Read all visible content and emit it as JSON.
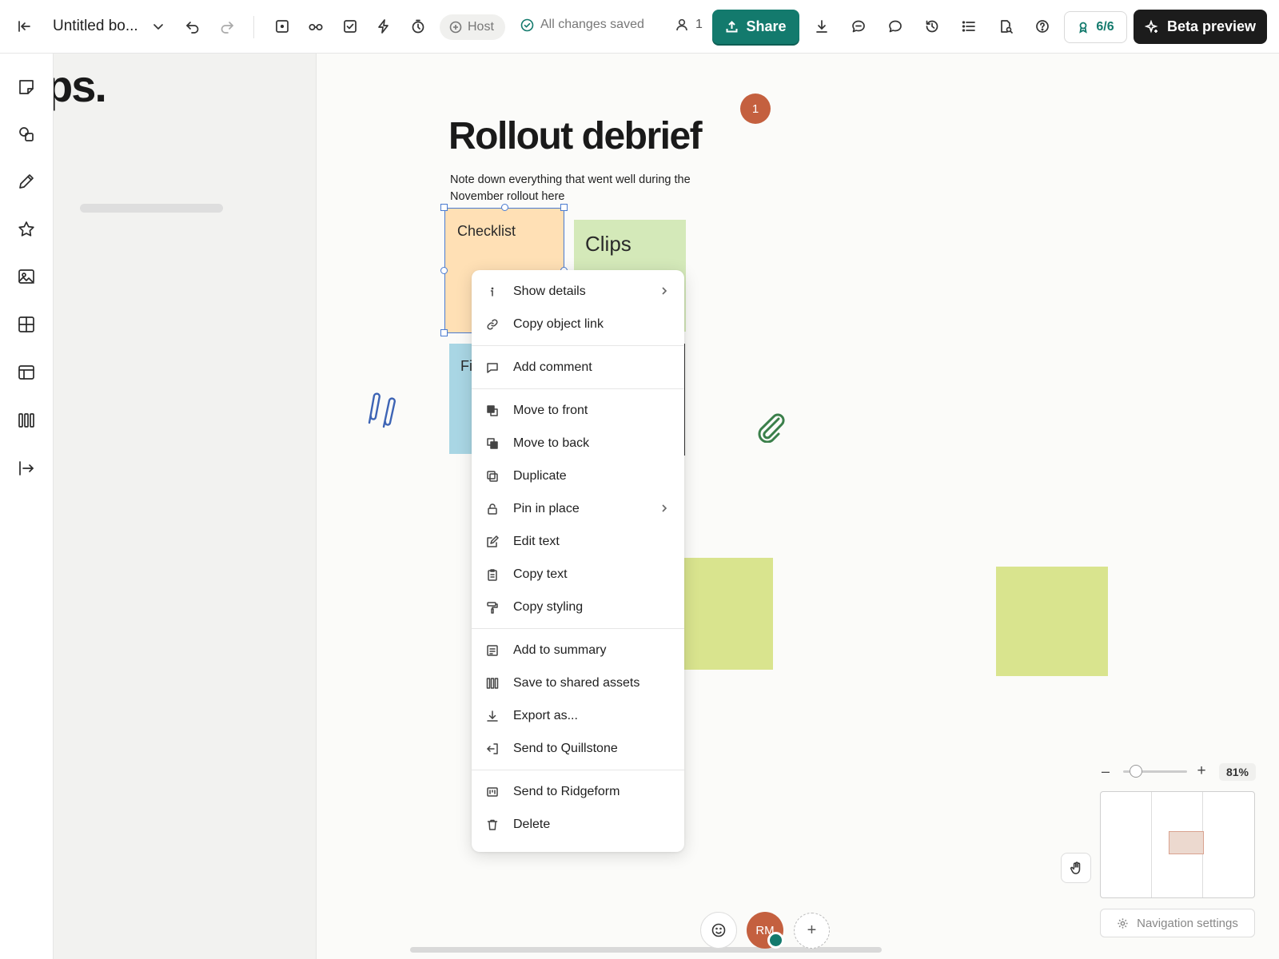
{
  "topbar": {
    "board_title": "Untitled bo...",
    "host_label": "Host",
    "save_status": "All changes saved",
    "collaborators_count": "1",
    "share_label": "Share",
    "badge_count": "6/6",
    "beta_label": "Beta preview"
  },
  "frame": {
    "heading": "ps."
  },
  "board": {
    "heading": "Rollout debrief",
    "note": "Note down everything that went well during the November rollout here",
    "marker_count": "1",
    "stickies": {
      "checklist": "Checklist",
      "clips": "Clips",
      "blue": "Fi"
    }
  },
  "context_menu": {
    "items": [
      {
        "label": "Show details",
        "icon": "info-icon",
        "submenu": true
      },
      {
        "label": "Copy object link",
        "icon": "link-icon"
      },
      {
        "label": "Add comment",
        "icon": "comment-icon"
      },
      {
        "label": "Move to front",
        "icon": "bring-front-icon"
      },
      {
        "label": "Move to back",
        "icon": "send-back-icon"
      },
      {
        "label": "Duplicate",
        "icon": "duplicate-icon"
      },
      {
        "label": "Pin in place",
        "icon": "lock-icon",
        "submenu": true
      },
      {
        "label": "Edit text",
        "icon": "edit-icon"
      },
      {
        "label": "Copy text",
        "icon": "clipboard-icon"
      },
      {
        "label": "Copy styling",
        "icon": "paint-roller-icon"
      },
      {
        "label": "Add to summary",
        "icon": "summary-icon"
      },
      {
        "label": "Save to shared assets",
        "icon": "library-icon"
      },
      {
        "label": "Export as...",
        "icon": "download-icon"
      },
      {
        "label": "Send to Quillstone",
        "icon": "send-icon"
      },
      {
        "label": "Send to Ridgeform",
        "icon": "board-icon"
      },
      {
        "label": "Delete",
        "icon": "trash-icon"
      }
    ]
  },
  "zoom": {
    "value": "81%",
    "level": 0.2
  },
  "navigation": {
    "settings_label": "Navigation settings"
  },
  "user": {
    "initials": "RM"
  },
  "colors": {
    "accent": "#137a6d",
    "avatar": "#c4603f",
    "sticky_orange": "#ffe0b5",
    "sticky_green": "#d4e9b9",
    "sticky_blue": "#a9d6e4",
    "sticky_lime": "#d9e48e"
  }
}
